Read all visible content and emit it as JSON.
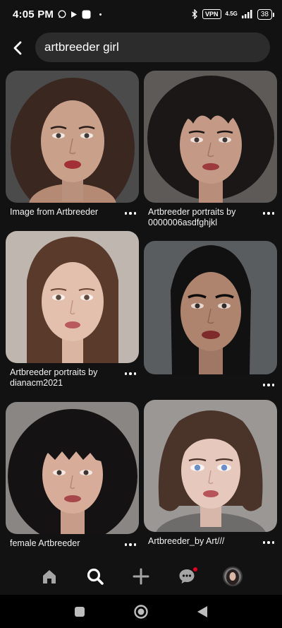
{
  "status_bar": {
    "time": "4:05 PM",
    "vpn": "VPN",
    "network": "4.5G",
    "battery": "38"
  },
  "search": {
    "query": "artbreeder girl"
  },
  "pins": [
    {
      "caption": "Image from Artbreeder",
      "hair": "#3a2720",
      "skin": "#c9a08a",
      "lips": "#a23036",
      "bg": "#4b4b4b"
    },
    {
      "caption": "Artbreeder portraits by 0000006asdfghjkl",
      "hair": "#1a1716",
      "skin": "#c49a86",
      "lips": "#9c3a3e",
      "bg": "#5e5a57"
    },
    {
      "caption": "Artbreeder portraits by dianacm2021",
      "hair": "#5a3a2b",
      "skin": "#e2c0ad",
      "lips": "#b95a5e",
      "bg": "#bfb6b0"
    },
    {
      "caption": "",
      "hair": "#121111",
      "skin": "#ae846f",
      "lips": "#7e2b2c",
      "bg": "#5a5d60"
    },
    {
      "caption": "female Artbreeder",
      "hair": "#141213",
      "skin": "#d7ad9a",
      "lips": "#a8474a",
      "bg": "#8a8683"
    },
    {
      "caption": "Artbreeder_by Art///",
      "hair": "#4a342a",
      "skin": "#e6c8bd",
      "lips": "#b6545a",
      "bg": "#9b9794"
    }
  ],
  "icons": {
    "back": "back-arrow-icon",
    "more": "more-dots-icon",
    "home": "home-icon",
    "search": "search-icon",
    "create": "plus-icon",
    "messages": "chat-bubble-icon",
    "profile": "avatar",
    "sys_recents": "square-icon",
    "sys_home": "circle-icon",
    "sys_back": "triangle-back-icon"
  },
  "colors": {
    "background": "#121212",
    "search_field": "#2c2c2c",
    "notification": "#e60023"
  }
}
